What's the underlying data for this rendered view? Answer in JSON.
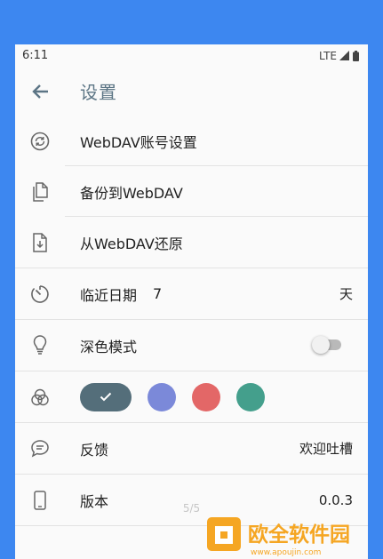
{
  "status_bar": {
    "time": "6:11",
    "network": "LTE"
  },
  "app_bar": {
    "title": "设置"
  },
  "settings": {
    "webdav_account": "WebDAV账号设置",
    "backup": "备份到WebDAV",
    "restore": "从WebDAV还原",
    "due_days": {
      "label": "临近日期",
      "value": "7",
      "unit": "天"
    },
    "dark_mode": {
      "label": "深色模式",
      "enabled": false
    },
    "theme_colors": {
      "options": [
        "#546e7a",
        "#7b89d9",
        "#e36767",
        "#449f8c"
      ],
      "selected_index": 0
    },
    "feedback": {
      "label": "反馈",
      "value": "欢迎吐槽"
    },
    "version": {
      "label": "版本",
      "value": "0.0.3"
    }
  },
  "page_indicator": "5/5",
  "watermark": {
    "name": "欧全软件园",
    "url": "www.apoujin.com",
    "color": "#f5a623"
  }
}
